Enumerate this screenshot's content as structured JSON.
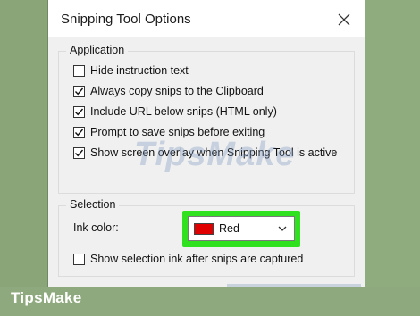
{
  "window": {
    "title": "Snipping Tool Options"
  },
  "application_group": {
    "label": "Application",
    "options": [
      {
        "label": "Hide instruction text",
        "checked": false
      },
      {
        "label": "Always copy snips to the Clipboard",
        "checked": true
      },
      {
        "label": "Include URL below snips (HTML only)",
        "checked": true
      },
      {
        "label": "Prompt to save snips before exiting",
        "checked": true
      },
      {
        "label": "Show screen overlay when Snipping Tool is active",
        "checked": true
      }
    ]
  },
  "selection_group": {
    "label": "Selection",
    "ink_color_label": "Ink color:",
    "ink_color_value": "Red",
    "ink_color_swatch": "#e00000",
    "show_ink_option": {
      "label": "Show selection ink after snips are captured",
      "checked": false
    }
  },
  "watermark": "TipsMake",
  "brand": "TipsMake",
  "colors": {
    "highlight": "#2fe11e",
    "background": "#8fa97e"
  }
}
